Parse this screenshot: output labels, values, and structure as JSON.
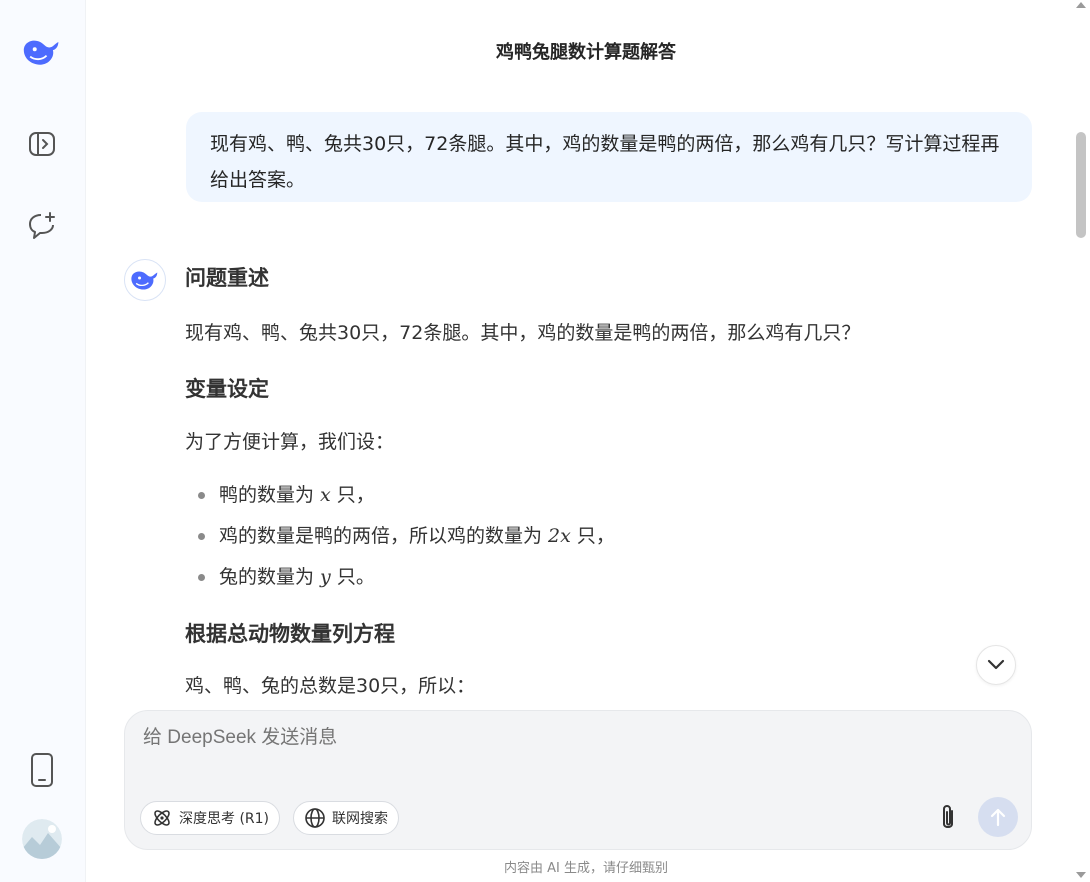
{
  "app": {
    "brand_color": "#4d6bfe",
    "title": "鸡鸭兔腿数计算题解答"
  },
  "sidebar": {
    "icons": [
      "deepseek-logo-icon",
      "sidebar-toggle-icon",
      "new-chat-icon",
      "mobile-app-icon",
      "user-avatar"
    ]
  },
  "conversation": {
    "user_message": "现有鸡、鸭、兔共30只，72条腿。其中，鸡的数量是鸭的两倍，那么鸡有几只？写计算过程再给出答案。",
    "answer": {
      "heading1": "问题重述",
      "para1": "现有鸡、鸭、兔共30只，72条腿。其中，鸡的数量是鸭的两倍，那么鸡有几只？",
      "heading2": "变量设定",
      "para2": "为了方便计算，我们设：",
      "bullets": [
        {
          "before": "鸭的数量为 ",
          "math": "x",
          "after": " 只，"
        },
        {
          "before": "鸡的数量是鸭的两倍，所以鸡的数量为 ",
          "math": "2x",
          "after": " 只，"
        },
        {
          "before": "兔的数量为 ",
          "math": "y",
          "after": " 只。"
        }
      ],
      "heading3": "根据总动物数量列方程",
      "para3": "鸡、鸭、兔的总数是30只，所以："
    }
  },
  "composer": {
    "placeholder": "给 DeepSeek 发送消息",
    "deep_think_label": "深度思考 (R1)",
    "web_search_label": "联网搜索"
  },
  "footer": {
    "disclaimer": "内容由 AI 生成，请仔细甄别"
  }
}
